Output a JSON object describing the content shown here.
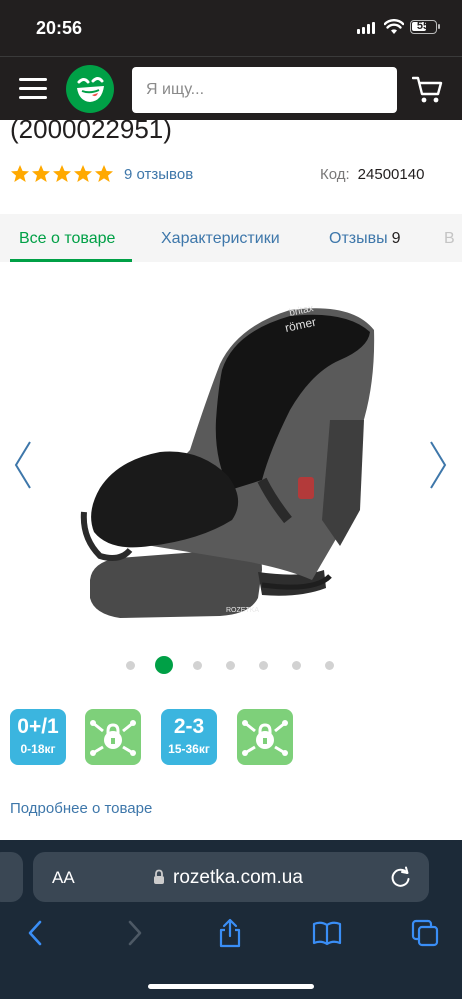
{
  "status_bar": {
    "time": "20:56",
    "battery": "55"
  },
  "header": {
    "menu_icon": "hamburger-icon",
    "logo_icon": "rozetka-smile-logo",
    "search": {
      "placeholder": "Я ищу...",
      "value": ""
    },
    "cart_icon": "cart-icon"
  },
  "product": {
    "title_fragment": "(2000022951)",
    "rating": {
      "stars": 5,
      "reviews_label": "9 отзывов"
    },
    "code_label": "Код:",
    "code_value": "24500140"
  },
  "tabs": [
    {
      "label": "Все о товаре",
      "active": true
    },
    {
      "label": "Характеристики",
      "active": false
    },
    {
      "label": "Отзывы",
      "count": "9",
      "active": false
    },
    {
      "label": "В",
      "active": false
    }
  ],
  "gallery": {
    "brand_logo_line1": "britax",
    "brand_logo_line2": "römer",
    "watermark": "ROZETKA",
    "dots": 7,
    "active_dot": 2
  },
  "badges": [
    {
      "big": "0+/1",
      "small": "0-18кг",
      "color": "#3bb5df",
      "icon": ""
    },
    {
      "big": "",
      "small": "",
      "color": "#7ed07a",
      "icon": "isofix-lock-icon"
    },
    {
      "big": "2-3",
      "small": "15-36кг",
      "color": "#3bb5df",
      "icon": ""
    },
    {
      "big": "",
      "small": "",
      "color": "#7ed07a",
      "icon": "isofix-lock-icon"
    }
  ],
  "more_link": "Подробнее о товаре",
  "browser": {
    "aa_label": "AA",
    "domain": "rozetka.com.ua"
  },
  "colors": {
    "accent": "#00a046",
    "link": "#3e77aa",
    "star": "#ffa900",
    "header_bg": "#221f1f"
  }
}
